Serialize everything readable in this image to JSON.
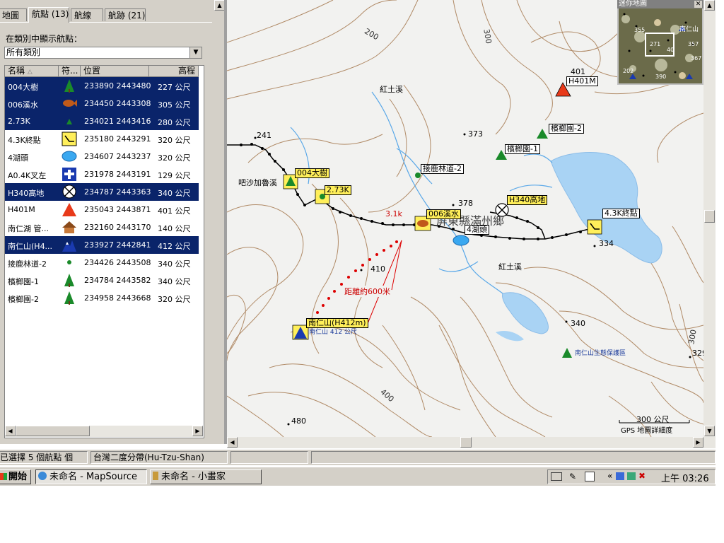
{
  "tabs": [
    "地圖",
    "航點 (13)",
    "航線",
    "航跡 (21)"
  ],
  "filter_label": "在類別中顯示航點：",
  "category_value": "所有類別",
  "columns": [
    "名稱",
    "符...",
    "位置",
    "高程"
  ],
  "waypoints": [
    {
      "name": "004大樹",
      "symbol": "tree-icon",
      "position": "233890 2443480",
      "elevation": "227 公尺",
      "selected": true
    },
    {
      "name": "006溪水",
      "symbol": "fish-icon",
      "position": "234450 2443308",
      "elevation": "305 公尺",
      "selected": true
    },
    {
      "name": "2.73K",
      "symbol": "small-tree-icon",
      "position": "234021 2443416",
      "elevation": "280 公尺",
      "selected": true
    },
    {
      "name": "4.3K終點",
      "symbol": "trail-end-icon",
      "position": "235180 2443291",
      "elevation": "320 公尺",
      "selected": false
    },
    {
      "name": "4湖頭",
      "symbol": "lake-icon",
      "position": "234607 2443237",
      "elevation": "320 公尺",
      "selected": false
    },
    {
      "name": "A0.4K叉左",
      "symbol": "medical-cross-icon",
      "position": "231978 2443191",
      "elevation": "129 公尺",
      "selected": false
    },
    {
      "name": "H340高地",
      "symbol": "crossed-circle-icon",
      "position": "234787 2443363",
      "elevation": "340 公尺",
      "selected": true
    },
    {
      "name": "H401M",
      "symbol": "red-triangle-icon",
      "position": "235043 2443871",
      "elevation": "401 公尺",
      "selected": false
    },
    {
      "name": "南仁湖 管...",
      "symbol": "house-icon",
      "position": "232160 2443170",
      "elevation": "140 公尺",
      "selected": false
    },
    {
      "name": "南仁山(H4...",
      "symbol": "mountain-icon",
      "position": "233927 2442841",
      "elevation": "412 公尺",
      "selected": true
    },
    {
      "name": "接鹿林道-2",
      "symbol": "green-dot-icon",
      "position": "234426 2443508",
      "elevation": "340 公尺",
      "selected": false
    },
    {
      "name": "檳榔園-1",
      "symbol": "tree-icon",
      "position": "234784 2443582",
      "elevation": "340 公尺",
      "selected": false
    },
    {
      "name": "檳榔園-2",
      "symbol": "tree-icon",
      "position": "234958 2443668",
      "elevation": "320 公尺",
      "selected": false
    }
  ],
  "map": {
    "contour_labels": [
      "200",
      "300",
      "410",
      "400",
      "300"
    ],
    "spot_heights": [
      "401",
      "241",
      "373",
      "378",
      "410",
      "334",
      "340",
      "480",
      "329"
    ],
    "place_labels": [
      "紅土溪",
      "吧沙加魯溪",
      "紅土溪",
      "屏東縣滿州鄉",
      "南仁山生態保護區"
    ],
    "waypoint_labels": [
      "H401M",
      "檳榔園-2",
      "檳榔園-1",
      "接鹿林道-2",
      "004大樹",
      "2.73K",
      "H340高地",
      "006溪水",
      "4湖頭",
      "4.3K終點",
      "南仁山(H412m)"
    ],
    "peak_sublabel": "南仁山 412 公尺",
    "track_distance": "3.1k",
    "annotation": "距離約600米",
    "scale_value": "300 公尺",
    "scale_caption": "GPS 地圖詳細度",
    "minimap_title": "迷你地圖",
    "minimap_labels": [
      "355",
      "南仁山",
      "271",
      "357",
      "367",
      "40",
      "202",
      "390"
    ]
  },
  "status": {
    "selection": "已選擇 5 個航點 個",
    "grid": "台灣二度分帶(Hu-Tzu-Shan)"
  },
  "taskbar": {
    "start": "開始",
    "apps": [
      "未命名 - MapSource",
      "未命名 - 小畫家"
    ],
    "clock": "上午 03:26"
  },
  "colors": {
    "selection": "#0a246a",
    "water": "#a9d3f4",
    "contour": "#b08a66",
    "track": "#000000",
    "route_red": "#dd0000",
    "waypoint_label_bg": "#ffef5a"
  }
}
